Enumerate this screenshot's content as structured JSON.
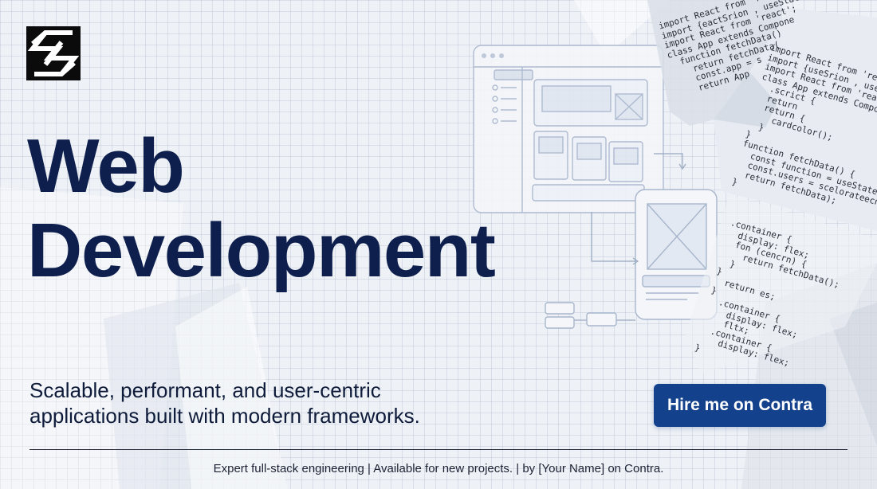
{
  "logo": {
    "icon": "lightning-arrows-logo"
  },
  "headline": {
    "line1": "Web",
    "line2": "Development"
  },
  "tagline": {
    "line1": "Scalable, performant, and user-centric",
    "line2": "applications built with modern frameworks."
  },
  "cta": {
    "label": "Hire me on Contra"
  },
  "footer": {
    "text": "Expert full-stack engineering | Available for new projects. | by [Your Name] on Contra."
  },
  "code": {
    "sheet1": [
      "import React from 'react'",
      "import {eactSrion , useState",
      "import React from 'react';",
      "",
      "class App extends Compone",
      "  function fetchData()",
      "    return fetchData(",
      "    const.app = s",
      "    return App"
    ],
    "sheet2": [
      "import React from 'react",
      "import {useSrion , use$",
      "import React from 'react",
      "",
      "class App extends Componen",
      "  .scrict {",
      "  return",
      "  return {",
      "    cardcolor();",
      "  }",
      "}",
      "",
      "function fetchData() {",
      "  const function = useState()",
      "  const.users = scelorateecnea",
      "  return fetchData);",
      "}"
    ],
    "sheet3": [
      ".container {",
      "  display: flex;",
      "  fon (cencrn) {",
      "    return fetchData();",
      "  }",
      "}",
      "  return es;",
      "}",
      "",
      "  .container {",
      "    display: flex;",
      "    fltx;",
      "",
      "  .container {",
      "    display: flex;",
      "}"
    ]
  },
  "colors": {
    "headline": "#0e1f4d",
    "cta_bg": "#13418c",
    "text": "#0e1b3a",
    "background": "#eef1f6"
  }
}
